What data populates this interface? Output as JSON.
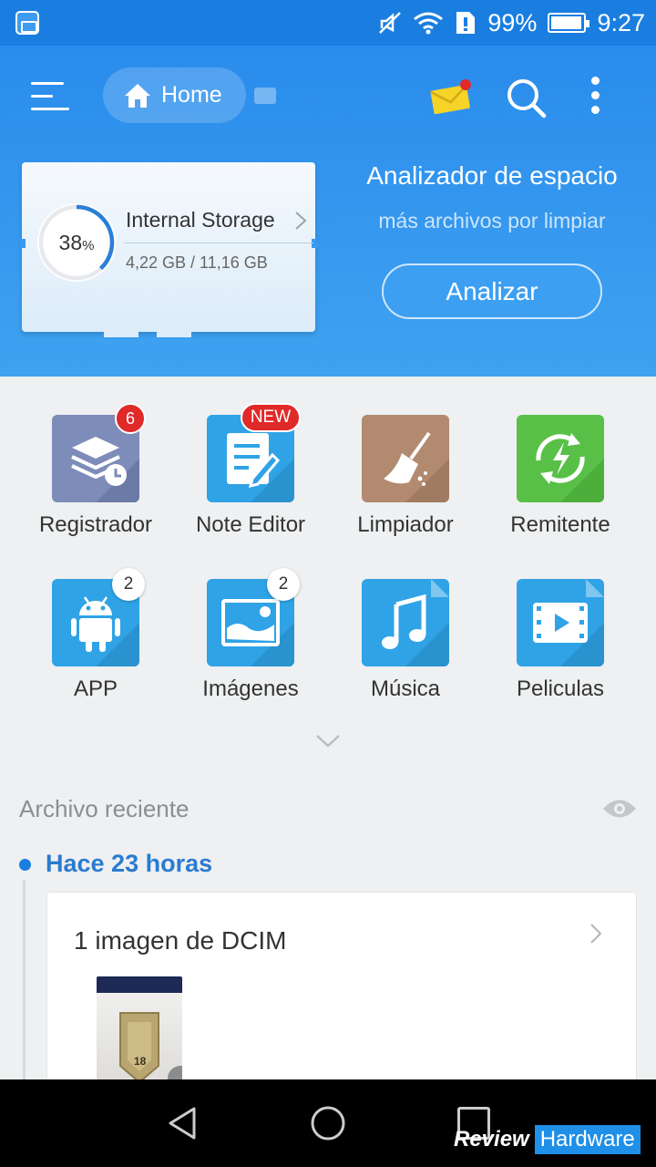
{
  "status_bar": {
    "battery": "99%",
    "time": "9:27"
  },
  "header": {
    "breadcrumb": "Home",
    "storage": {
      "percent": "38",
      "percent_sign": "%",
      "title": "Internal Storage",
      "used": "4,22 GB / 11,16 GB",
      "fraction_used": 0.38
    },
    "analyzer": {
      "title": "Analizador de espacio",
      "subtitle": "más archivos por limpiar",
      "button": "Analizar"
    }
  },
  "categories": [
    {
      "label": "Registrador",
      "icon": "layers-clock-icon",
      "badge": "6"
    },
    {
      "label": "Note Editor",
      "icon": "note-edit-icon",
      "badge": "NEW"
    },
    {
      "label": "Limpiador",
      "icon": "broom-icon",
      "badge": ""
    },
    {
      "label": "Remitente",
      "icon": "sync-bolt-icon",
      "badge": ""
    },
    {
      "label": "APP",
      "icon": "android-icon",
      "badge": "2"
    },
    {
      "label": "Imágenes",
      "icon": "image-icon",
      "badge": "2"
    },
    {
      "label": "Música",
      "icon": "music-note-icon",
      "badge": ""
    },
    {
      "label": "Peliculas",
      "icon": "video-icon",
      "badge": ""
    }
  ],
  "recent": {
    "title": "Archivo reciente",
    "group_time": "Hace 23 horas",
    "item_title": "1 imagen de DCIM",
    "thumbnail_number": "18"
  },
  "watermark": {
    "part1": "Review",
    "part2": "Hardware"
  },
  "colors": {
    "primary": "#1a7ee0",
    "header": "#3fa2f0",
    "badge": "#e02929",
    "reg_tile": "#7d8cb8",
    "note_tile": "#2fa3e6",
    "clean_tile": "#b18a70",
    "send_tile": "#58c046",
    "blue_tile": "#2fa3e6"
  }
}
